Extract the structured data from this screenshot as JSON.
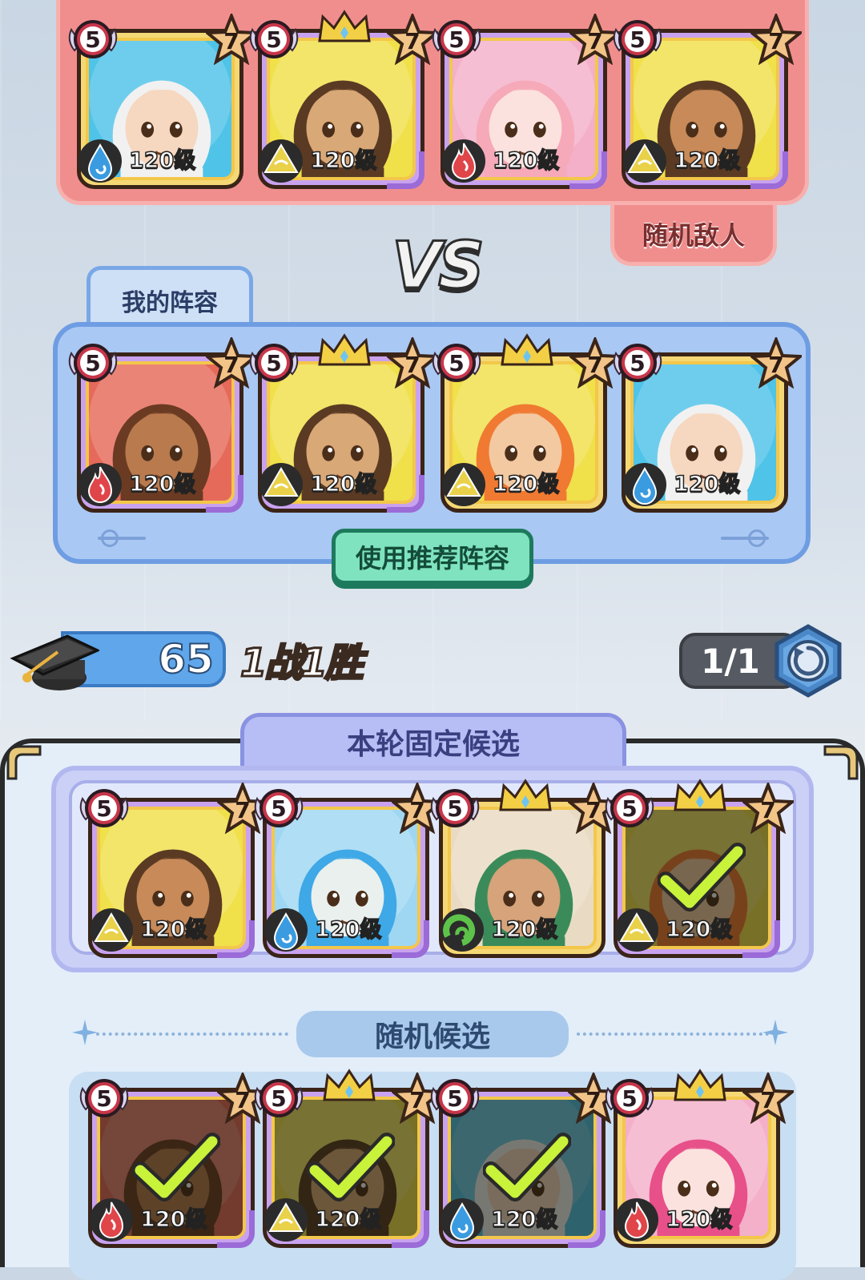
{
  "enemy": {
    "label": "随机敌人",
    "heroes": [
      {
        "rank": "5",
        "stars": "7",
        "level": "120级",
        "element": "water",
        "bg": "#4fc3e8",
        "hair": "#f1f1f1",
        "skin": "#f6d7c0",
        "crown": false,
        "selected": false,
        "purple": false
      },
      {
        "rank": "5",
        "stars": "7",
        "level": "120级",
        "element": "earth",
        "bg": "#f0e04a",
        "hair": "#5a3a22",
        "skin": "#d9a877",
        "crown": true,
        "selected": false,
        "purple": true
      },
      {
        "rank": "5",
        "stars": "7",
        "level": "120级",
        "element": "fire",
        "bg": "#f3b0c8",
        "hair": "#f6a9b8",
        "skin": "#fbe2de",
        "crown": false,
        "selected": false,
        "purple": true
      },
      {
        "rank": "5",
        "stars": "7",
        "level": "120级",
        "element": "earth",
        "bg": "#f0e04a",
        "hair": "#5a3a22",
        "skin": "#c78a58",
        "crown": false,
        "selected": false,
        "purple": true
      }
    ]
  },
  "vs_text": "VS",
  "my_team": {
    "label": "我的阵容",
    "recommend_button": "使用推荐阵容",
    "heroes": [
      {
        "rank": "5",
        "stars": "7",
        "level": "120级",
        "element": "fire",
        "bg": "#e66a5a",
        "hair": "#6a3b22",
        "skin": "#b97a4e",
        "crown": false,
        "selected": false,
        "purple": true
      },
      {
        "rank": "5",
        "stars": "7",
        "level": "120级",
        "element": "earth",
        "bg": "#f0e04a",
        "hair": "#5a3a22",
        "skin": "#d9a877",
        "crown": true,
        "selected": false,
        "purple": true
      },
      {
        "rank": "5",
        "stars": "7",
        "level": "120级",
        "element": "earth",
        "bg": "#f0e04a",
        "hair": "#f07a32",
        "skin": "#f3c9a2",
        "crown": true,
        "selected": false,
        "purple": false
      },
      {
        "rank": "5",
        "stars": "7",
        "level": "120级",
        "element": "water",
        "bg": "#4fc3e8",
        "hair": "#f1f1f1",
        "skin": "#f6d7c0",
        "crown": false,
        "selected": false,
        "purple": false
      }
    ]
  },
  "stats": {
    "score": "65",
    "record": "1战1胜",
    "count": "1/1"
  },
  "fixed": {
    "label": "本轮固定候选",
    "heroes": [
      {
        "rank": "5",
        "stars": "7",
        "level": "120级",
        "element": "earth",
        "bg": "#f0e04a",
        "hair": "#5a3a22",
        "skin": "#c78a58",
        "crown": false,
        "selected": false,
        "purple": true
      },
      {
        "rank": "5",
        "stars": "7",
        "level": "120级",
        "element": "water",
        "bg": "#9fd7f2",
        "hair": "#3fa8e6",
        "skin": "#eaf0ee",
        "crown": false,
        "selected": false,
        "purple": true
      },
      {
        "rank": "5",
        "stars": "7",
        "level": "120级",
        "element": "wind",
        "bg": "#e9dbc3",
        "hair": "#3b8b5a",
        "skin": "#d6a37a",
        "crown": true,
        "selected": false,
        "purple": false
      },
      {
        "rank": "5",
        "stars": "7",
        "level": "120级",
        "element": "earth",
        "bg": "#f0e04a",
        "hair": "#f07a32",
        "skin": "#f3c9a2",
        "crown": true,
        "selected": true,
        "purple": true
      }
    ]
  },
  "random": {
    "label": "随机候选",
    "heroes": [
      {
        "rank": "5",
        "stars": "7",
        "level": "120级",
        "element": "fire",
        "bg": "#e66a5a",
        "hair": "#6a3b22",
        "skin": "#b97a4e",
        "crown": false,
        "selected": true,
        "purple": true
      },
      {
        "rank": "5",
        "stars": "7",
        "level": "120级",
        "element": "earth",
        "bg": "#f0e04a",
        "hair": "#5a3a22",
        "skin": "#d9a877",
        "crown": true,
        "selected": true,
        "purple": true
      },
      {
        "rank": "5",
        "stars": "7",
        "level": "120级",
        "element": "water",
        "bg": "#4fc3e8",
        "hair": "#f1f1f1",
        "skin": "#f6d7c0",
        "crown": false,
        "selected": true,
        "purple": true
      },
      {
        "rank": "5",
        "stars": "7",
        "level": "120级",
        "element": "fire",
        "bg": "#f3b0c8",
        "hair": "#e8508a",
        "skin": "#fbe2de",
        "crown": true,
        "selected": false,
        "purple": false
      }
    ]
  },
  "colors": {
    "enemy_panel": "#f08e8e",
    "my_panel": "#a9c8f3",
    "recommend_button": "#7fe3bf",
    "fixed_panel": "#cbd0f7",
    "random_panel": "#c8def3",
    "element_water": "#3a9be0",
    "element_earth": "#e9d14a",
    "element_fire": "#e0454a",
    "element_wind": "#5ec24a"
  }
}
